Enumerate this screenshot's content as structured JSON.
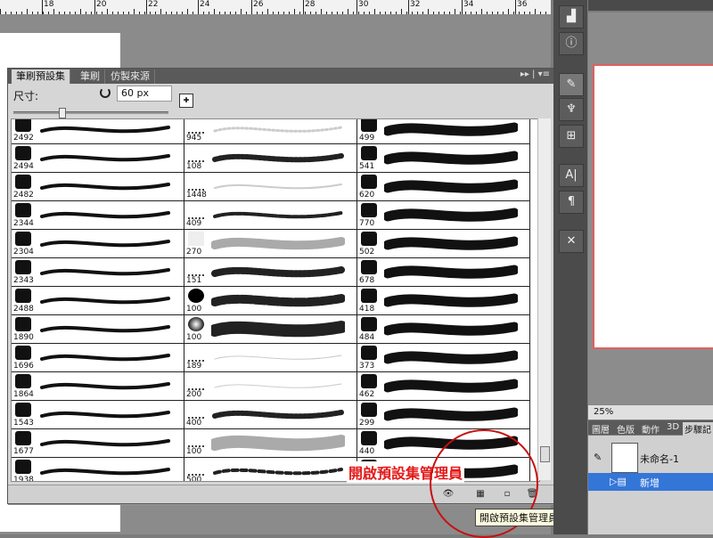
{
  "ruler": {
    "labels": [
      "18",
      "20",
      "22",
      "24",
      "26",
      "28",
      "30",
      "32",
      "34",
      "36"
    ]
  },
  "brush_panel": {
    "tabs": [
      "筆刷預設集",
      "筆刷",
      "仿製來源"
    ],
    "active_tab": "筆刷預設集",
    "size_label": "尺寸:",
    "size_value": "60 px",
    "brushes": {
      "col1": [
        "2492",
        "2494",
        "2482",
        "2344",
        "2304",
        "2343",
        "2488",
        "1890",
        "1696",
        "1864",
        "1543",
        "1677",
        "1938"
      ],
      "col2": [
        "945",
        "108",
        "1448",
        "409",
        "270",
        "151",
        "100",
        "100",
        "189",
        "200",
        "400",
        "100",
        "500"
      ],
      "col3": [
        "499",
        "541",
        "620",
        "770",
        "502",
        "678",
        "418",
        "484",
        "373",
        "462",
        "299",
        "440",
        "448"
      ]
    },
    "annotation_text": "開啟預設集管理員",
    "tooltip": "開啟預設集管理員"
  },
  "right_panel": {
    "zoom": "25%",
    "tabs": [
      "圖層",
      "色版",
      "動作",
      "3D",
      "步驟記"
    ],
    "active_tab": "步驟記",
    "history": {
      "snapshot_name": "未命名-1",
      "step_label": "新增"
    }
  },
  "colors": {
    "accent_red": "#e41919",
    "highlight_blue": "#3476d8"
  }
}
